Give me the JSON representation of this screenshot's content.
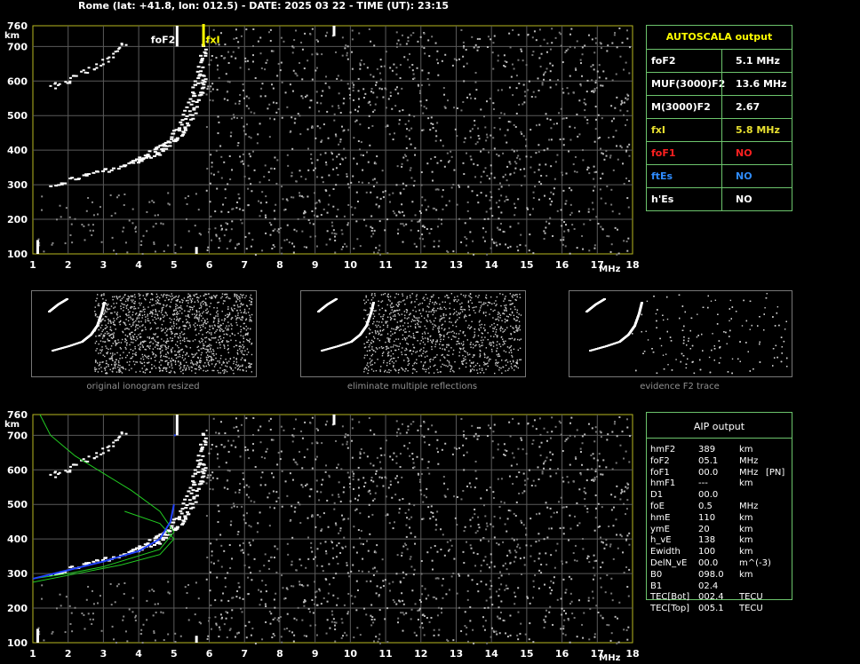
{
  "header": {
    "title": "Rome (lat: +41.8, lon: 012.5) - DATE: 2025 03 22 - TIME (UT): 23:15"
  },
  "top_plot": {
    "y_unit": "km",
    "x_unit": "MHz",
    "y_ticks": [
      "760",
      "700",
      "600",
      "500",
      "400",
      "300",
      "200",
      "100"
    ],
    "x_ticks": [
      "1",
      "2",
      "3",
      "4",
      "5",
      "6",
      "7",
      "8",
      "9",
      "10",
      "11",
      "12",
      "13",
      "14",
      "15",
      "16",
      "17",
      "18"
    ],
    "marker_fof2": "foF2",
    "marker_fxi": "fxI",
    "marker_colors": {
      "fof2": "#ffffff",
      "fxi": "#ffff00"
    }
  },
  "autoscala": {
    "title": "AUTOSCALA output",
    "rows": [
      {
        "label": "foF2",
        "value": "5.1 MHz",
        "color": "#ffffff"
      },
      {
        "label": "MUF(3000)F2",
        "value": "13.6 MHz",
        "color": "#ffffff"
      },
      {
        "label": "M(3000)F2",
        "value": "2.67",
        "color": "#ffffff"
      },
      {
        "label": "fxI",
        "value": "5.8 MHz",
        "color": "#e8e030"
      },
      {
        "label": "foF1",
        "value": "NO",
        "color": "#ff2020"
      },
      {
        "label": "ftEs",
        "value": "NO",
        "color": "#2f8cff"
      },
      {
        "label": "h'Es",
        "value": "NO",
        "color": "#ffffff"
      }
    ]
  },
  "thumbnails": [
    {
      "caption": "original ionogram resized"
    },
    {
      "caption": "eliminate multiple reflections"
    },
    {
      "caption": "evidence F2 trace"
    }
  ],
  "bottom_plot": {
    "y_unit": "km",
    "x_unit": "MHz",
    "y_ticks": [
      "760",
      "700",
      "600",
      "500",
      "400",
      "300",
      "200",
      "100"
    ],
    "x_ticks": [
      "1",
      "2",
      "3",
      "4",
      "5",
      "6",
      "7",
      "8",
      "9",
      "10",
      "11",
      "12",
      "13",
      "14",
      "15",
      "16",
      "17",
      "18"
    ]
  },
  "aip": {
    "title": "AIP output",
    "rows": [
      {
        "name": "hmF2",
        "value": "389",
        "unit": "km",
        "extra": ""
      },
      {
        "name": "foF2",
        "value": "05.1",
        "unit": "MHz",
        "extra": ""
      },
      {
        "name": "foF1",
        "value": "00.0",
        "unit": "MHz",
        "extra": "[PN]"
      },
      {
        "name": "hmF1",
        "value": "---",
        "unit": "km",
        "extra": ""
      },
      {
        "name": "D1",
        "value": "00.0",
        "unit": "",
        "extra": ""
      },
      {
        "name": "foE",
        "value": "0.5",
        "unit": "MHz",
        "extra": ""
      },
      {
        "name": "hmE",
        "value": "110",
        "unit": "km",
        "extra": ""
      },
      {
        "name": "ymE",
        "value": "20",
        "unit": "km",
        "extra": ""
      },
      {
        "name": "h_vE",
        "value": "138",
        "unit": "km",
        "extra": ""
      },
      {
        "name": "Ewidth",
        "value": "100",
        "unit": "km",
        "extra": ""
      },
      {
        "name": "DelN_vE",
        "value": "00.0",
        "unit": "m^(-3)",
        "extra": ""
      },
      {
        "name": "B0",
        "value": "098.0",
        "unit": "km",
        "extra": ""
      },
      {
        "name": "B1",
        "value": "02.4",
        "unit": "",
        "extra": ""
      },
      {
        "name": "TEC[Bot]",
        "value": "002.4",
        "unit": "TECU",
        "extra": ""
      },
      {
        "name": "TEC[Top]",
        "value": "005.1",
        "unit": "TECU",
        "extra": ""
      }
    ]
  }
}
